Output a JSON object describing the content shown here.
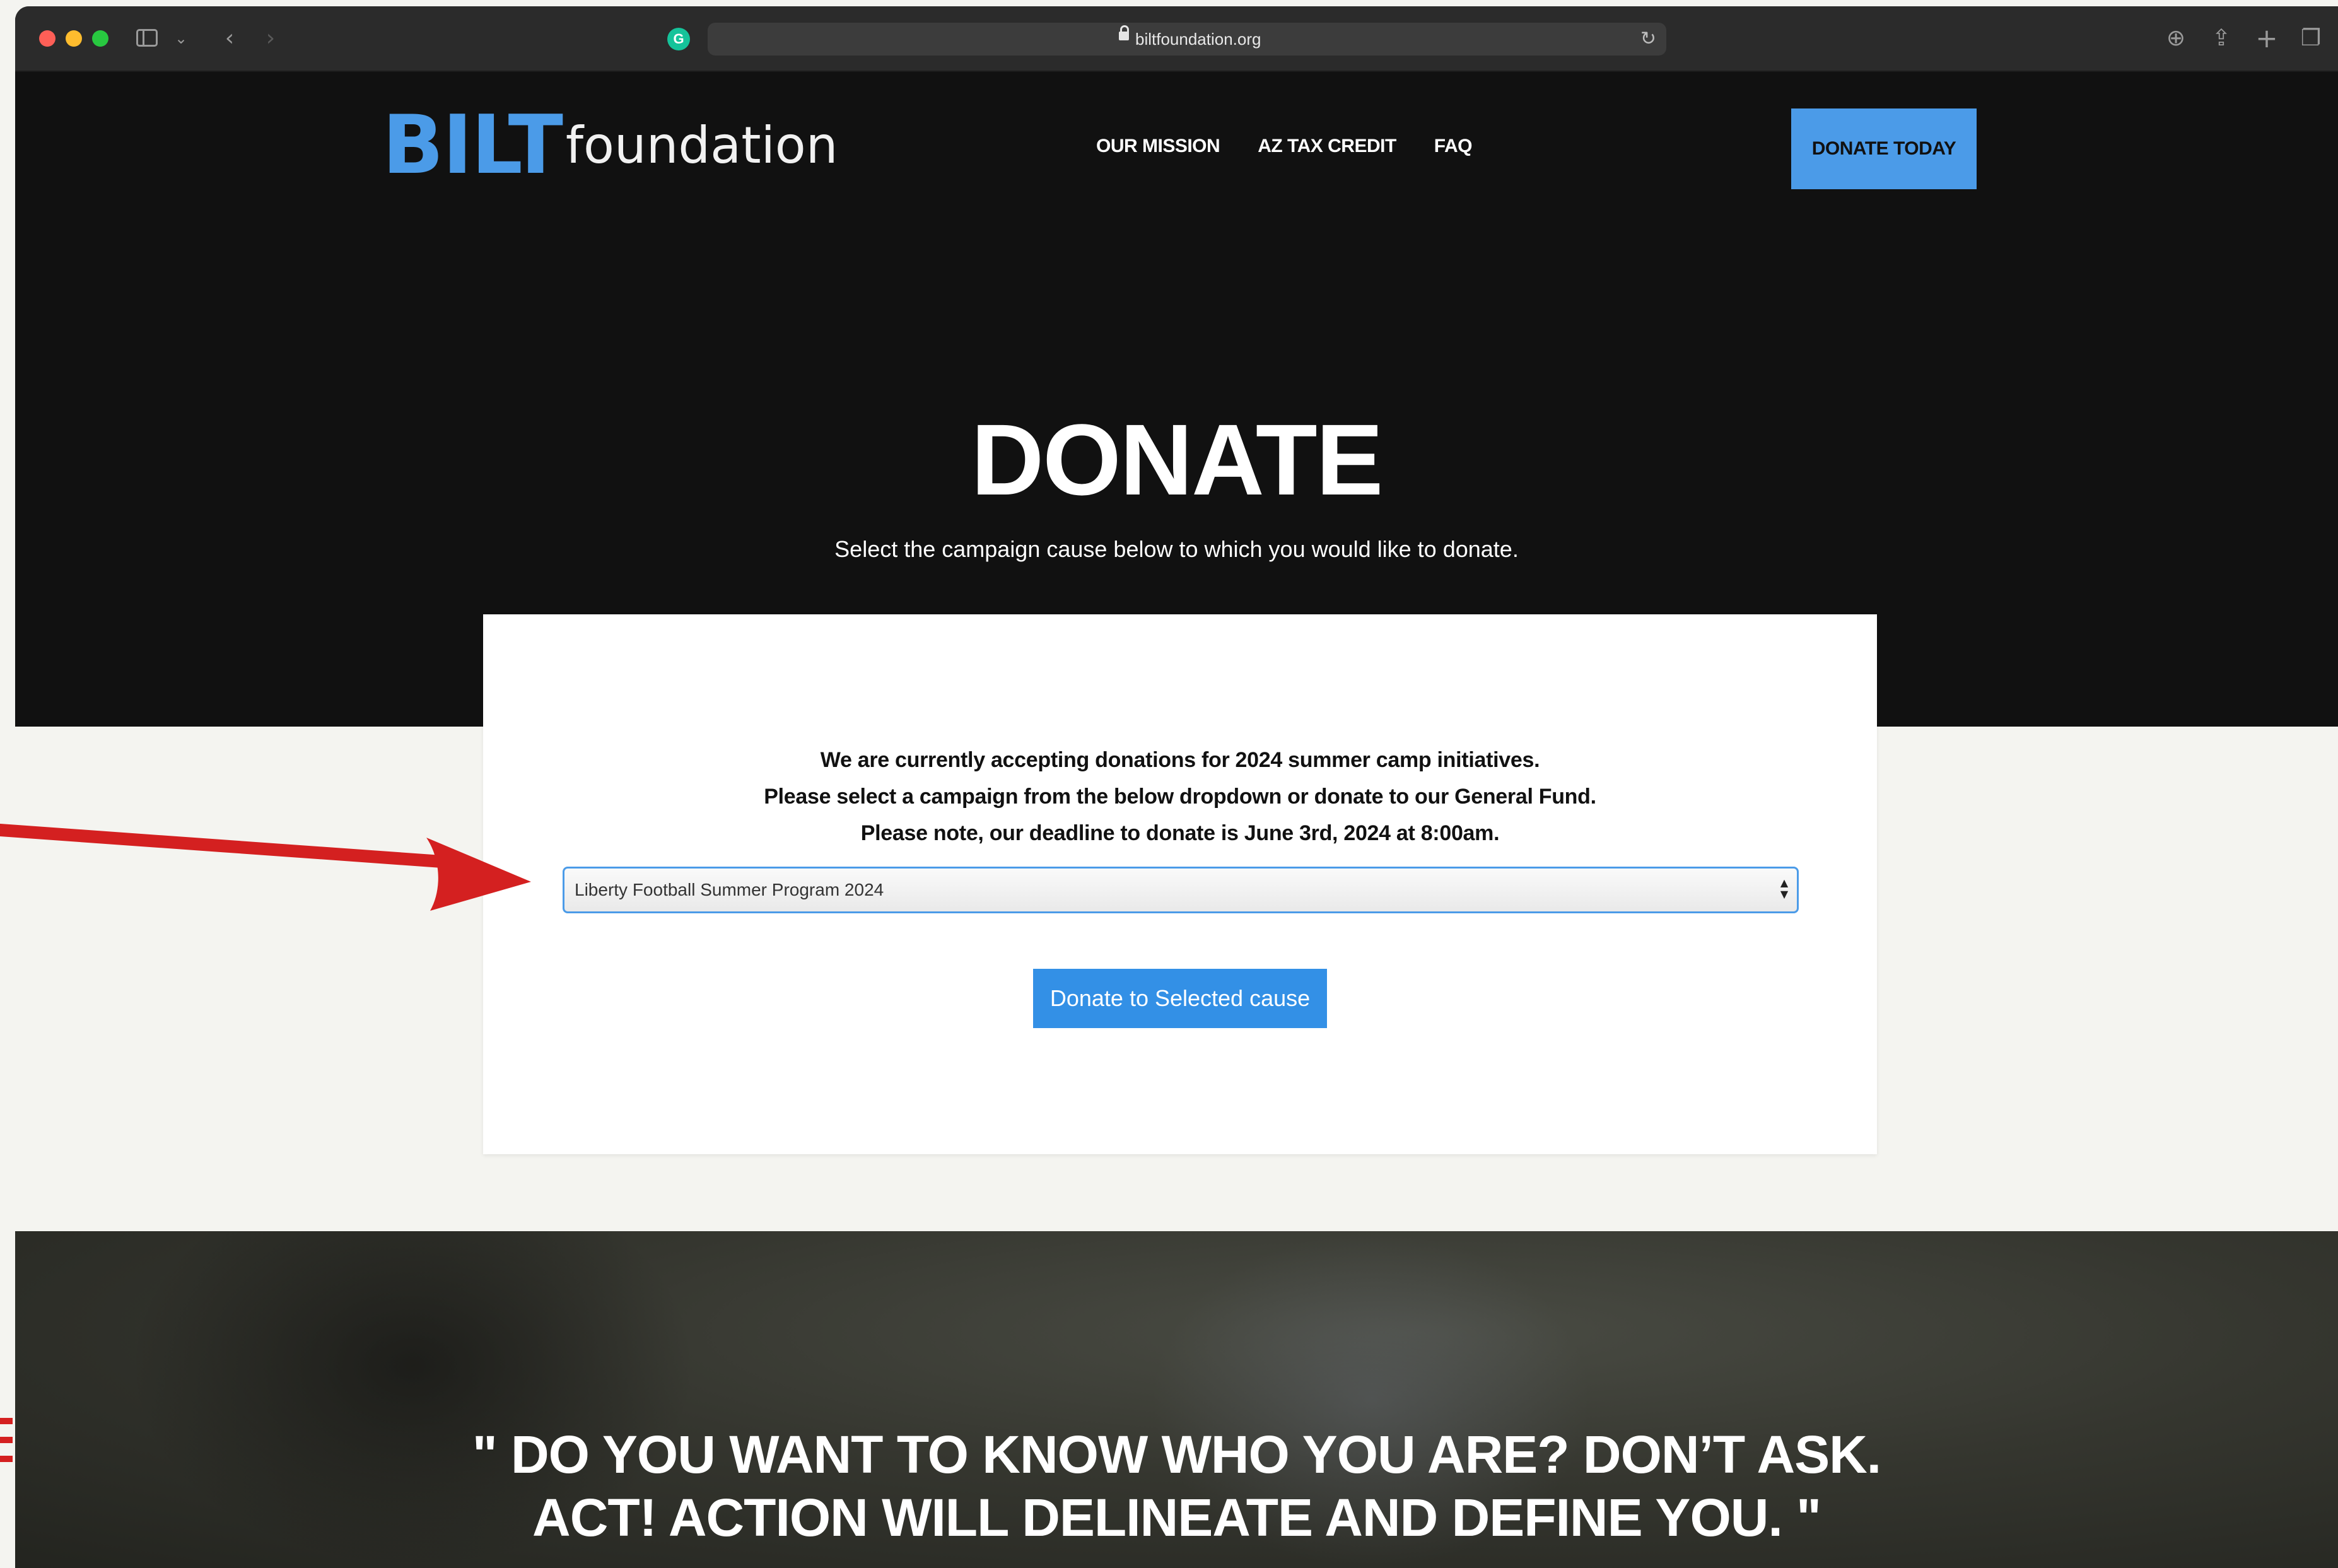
{
  "browser": {
    "url": "biltfoundation.org"
  },
  "site": {
    "logo": {
      "bilt": "BILT",
      "foundation": "foundation",
      "accent_color": "#4b9be8"
    },
    "nav": [
      {
        "label": "OUR MISSION"
      },
      {
        "label": "AZ TAX CREDIT"
      },
      {
        "label": "FAQ"
      }
    ],
    "donate_today_label": "DONATE TODAY"
  },
  "hero": {
    "title": "DONATE",
    "subtitle": "Select the campaign cause below to which you would like to donate."
  },
  "card": {
    "notice_lines": [
      "We are currently accepting donations for 2024 summer camp initiatives.",
      "Please select a campaign from the below dropdown or donate to our General Fund.",
      "Please note, our deadline to donate is June 3rd, 2024 at 8:00am."
    ],
    "campaign_select": {
      "selected": "Liberty Football Summer Program 2024"
    },
    "donate_button_label": "Donate to Selected cause",
    "button_color": "#3390e6"
  },
  "quote": {
    "line1": "\" DO YOU WANT TO KNOW WHO YOU ARE? DON’T ASK.",
    "line2": "ACT! ACTION WILL DELINEATE AND DEFINE YOU. \""
  },
  "icons": {
    "sidebar": "sidebar-icon",
    "back": "‹",
    "forward": "›",
    "chevron_down": "⌄",
    "reload": "↻",
    "download": "⊕",
    "share": "⇪",
    "new_tab": "+",
    "tabs": "❐",
    "select_arrows": "▲▼"
  },
  "annotation_color": "#d42020"
}
